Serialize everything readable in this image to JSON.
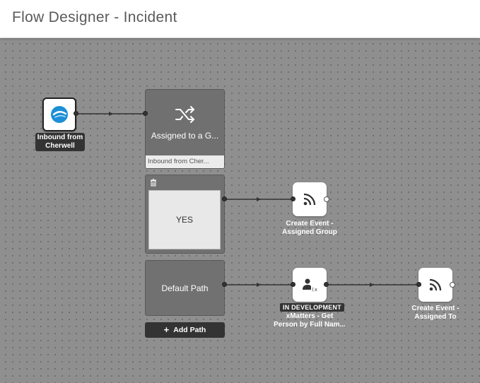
{
  "header": {
    "title": "Flow Designer - Incident"
  },
  "trigger": {
    "label_line1": "Inbound from",
    "label_line2": "Cherwell",
    "icon": "cherwell-logo-icon"
  },
  "switch": {
    "title": "Assigned to a G...",
    "subtitle": "Inbound from Cher...",
    "icon": "shuffle-icon"
  },
  "branches": [
    {
      "label": "YES",
      "icon": "trash-icon"
    },
    {
      "label": "Default Path"
    }
  ],
  "add_path": {
    "label": "Add Path",
    "icon": "plus-icon"
  },
  "steps": {
    "create_group": {
      "line1": "Create Event -",
      "line2": "Assigned Group",
      "icon": "rss-icon"
    },
    "get_person": {
      "badge": "IN DEVELOPMENT",
      "line1": "xMatters - Get",
      "line2": "Person by Full Nam...",
      "icon": "person-script-icon"
    },
    "create_to": {
      "line1": "Create Event -",
      "line2": "Assigned To",
      "icon": "rss-icon"
    }
  },
  "colors": {
    "canvas": "#8f8f8f",
    "card": "#6f6f6f",
    "accent": "#1c8fd6",
    "wire": "#333333"
  }
}
